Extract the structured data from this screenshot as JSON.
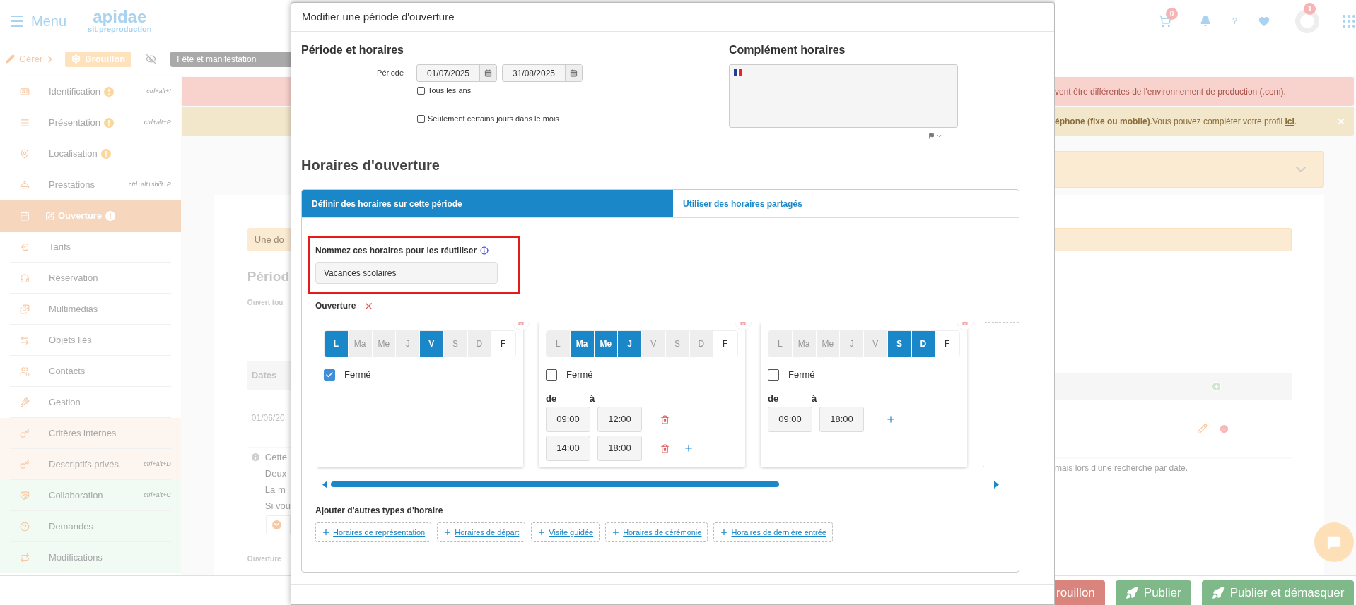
{
  "header": {
    "menu_label": "Menu",
    "logo_title": "apidae",
    "logo_subtitle": "sit.preproduction",
    "cart_count": "0",
    "help": "?",
    "profile_badge": "1"
  },
  "toolbar": {
    "manage": "Gérer",
    "status": "Brouillon",
    "category": "Fête et manifestation"
  },
  "sidebar": {
    "items": [
      {
        "label": "Identification",
        "warning": true,
        "shortcut": "ctrl+alt+I",
        "kind": "standard",
        "selected": false
      },
      {
        "label": "Présentation",
        "warning": true,
        "shortcut": "ctrl+alt+P",
        "kind": "standard",
        "selected": false
      },
      {
        "label": "Localisation",
        "warning": true,
        "kind": "standard",
        "selected": false
      },
      {
        "label": "Prestations",
        "warning": false,
        "shortcut": "ctrl+alt+shift+P",
        "kind": "standard",
        "selected": false
      },
      {
        "label": "Ouverture",
        "warning": true,
        "kind": "standard",
        "selected": true
      },
      {
        "label": "Tarifs",
        "warning": false,
        "kind": "standard",
        "selected": false
      },
      {
        "label": "Réservation",
        "warning": false,
        "kind": "standard",
        "selected": false
      },
      {
        "label": "Multimédias",
        "warning": false,
        "kind": "standard",
        "selected": false
      },
      {
        "label": "Objets liés",
        "warning": false,
        "kind": "standard",
        "selected": false
      },
      {
        "label": "Contacts",
        "warning": false,
        "kind": "standard",
        "selected": false
      },
      {
        "label": "Gestion",
        "warning": false,
        "kind": "standard",
        "selected": false
      },
      {
        "label": "Critères internes",
        "warning": false,
        "kind": "private",
        "selected": false
      },
      {
        "label": "Descriptifs privés",
        "warning": false,
        "shortcut": "ctrl+alt+D",
        "kind": "private",
        "selected": false
      },
      {
        "label": "Collaboration",
        "warning": false,
        "shortcut": "ctrl+alt+C",
        "kind": "shared",
        "selected": false
      },
      {
        "label": "Demandes",
        "warning": false,
        "kind": "shared",
        "selected": false
      },
      {
        "label": "Modifications",
        "warning": false,
        "kind": "shared",
        "selected": false
      }
    ]
  },
  "page_behind": {
    "alerts": [
      {
        "kind": "danger",
        "text": "vent être différentes de l'environnement de production (.com)."
      },
      {
        "kind": "warning",
        "text": "**éphone (fixe ou mobile)**.Vous pouvez compléter votre profil ",
        "link": "ici",
        "after": "."
      }
    ],
    "notice": "Une do",
    "heading": "Périod",
    "label": "Ouvert tou",
    "table_header": "Dates",
    "table_cell": "01/06/20",
    "note_lines": [
      "Cette",
      "Deux",
      "La m",
      "Si vou"
    ],
    "section": "Ouverture",
    "note_end": "mais lors d’une recherche par date.",
    "footer_buttons": [
      {
        "label": "rouillon",
        "kind": "danger"
      },
      {
        "label": "Publier",
        "kind": "publish"
      },
      {
        "label": "Publier et démasquer",
        "kind": "publish"
      }
    ]
  },
  "modal": {
    "title": "Modifier une période d'ouverture",
    "period": {
      "heading": "Période et horaires",
      "label": "Période",
      "start": "01/07/2025",
      "end": "31/08/2025",
      "options": [
        {
          "label": "Tous les ans",
          "checked": false
        },
        {
          "label": "Seulement certains jours dans le mois",
          "checked": false
        }
      ]
    },
    "complement": {
      "heading": "Complément horaires"
    },
    "hours": {
      "heading": "Horaires d'ouverture",
      "tabs": [
        {
          "label": "Définir des horaires sur cette période",
          "selected": true
        },
        {
          "label": "Utiliser des horaires partagés",
          "selected": false
        }
      ],
      "name_field": {
        "label": "Nommez ces horaires pour les réutiliser",
        "value": "Vacances scolaires",
        "highlighted": true
      },
      "group_label": "Ouverture",
      "schedules": [
        {
          "days": [
            {
              "label": "L",
              "kind": "day",
              "selected": true
            },
            {
              "label": "Ma",
              "kind": "day",
              "selected": false
            },
            {
              "label": "Me",
              "kind": "day",
              "selected": false
            },
            {
              "label": "J",
              "kind": "day",
              "selected": false
            },
            {
              "label": "V",
              "kind": "day",
              "selected": true
            },
            {
              "label": "S",
              "kind": "day",
              "selected": false
            },
            {
              "label": "D",
              "kind": "day",
              "selected": false
            },
            {
              "label": "F",
              "kind": "holiday",
              "selected": false
            }
          ],
          "closed_label": "Fermé",
          "closed": true
        },
        {
          "days": [
            {
              "label": "L",
              "kind": "day",
              "selected": false
            },
            {
              "label": "Ma",
              "kind": "day",
              "selected": true
            },
            {
              "label": "Me",
              "kind": "day",
              "selected": true
            },
            {
              "label": "J",
              "kind": "day",
              "selected": true
            },
            {
              "label": "V",
              "kind": "day",
              "selected": false
            },
            {
              "label": "S",
              "kind": "day",
              "selected": false
            },
            {
              "label": "D",
              "kind": "day",
              "selected": false
            },
            {
              "label": "F",
              "kind": "holiday",
              "selected": false
            }
          ],
          "closed_label": "Fermé",
          "closed": false,
          "from_label": "de",
          "to_label": "à",
          "slots": [
            {
              "start": "09:00",
              "end": "12:00"
            },
            {
              "start": "14:00",
              "end": "18:00"
            }
          ]
        },
        {
          "days": [
            {
              "label": "L",
              "kind": "day",
              "selected": false
            },
            {
              "label": "Ma",
              "kind": "day",
              "selected": false
            },
            {
              "label": "Me",
              "kind": "day",
              "selected": false
            },
            {
              "label": "J",
              "kind": "day",
              "selected": false
            },
            {
              "label": "V",
              "kind": "day",
              "selected": false
            },
            {
              "label": "S",
              "kind": "day",
              "selected": true
            },
            {
              "label": "D",
              "kind": "day",
              "selected": true
            },
            {
              "label": "F",
              "kind": "holiday",
              "selected": false
            }
          ],
          "closed_label": "Fermé",
          "closed": false,
          "from_label": "de",
          "to_label": "à",
          "slots": [
            {
              "start": "09:00",
              "end": "18:00"
            }
          ]
        }
      ],
      "add_types": {
        "heading": "Ajouter d'autres types d'horaire",
        "buttons": [
          "Horaires de représentation",
          "Horaires de départ",
          "Visite guidée",
          "Horaires de cérémonie",
          "Horaires de dernière entrée"
        ]
      }
    }
  }
}
